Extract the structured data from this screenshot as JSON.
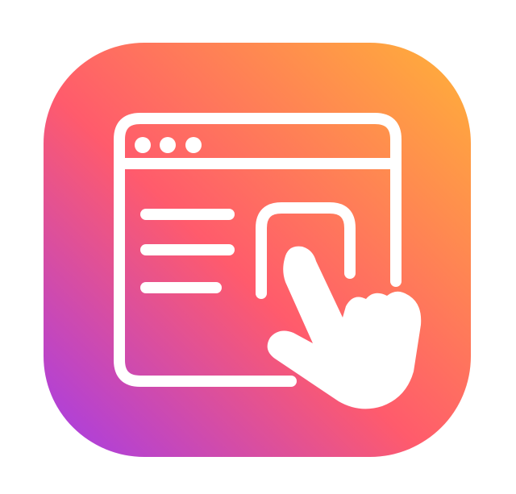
{
  "icon": {
    "name": "web-click-app-icon",
    "colors": {
      "gradient_top_right": "#FFB238",
      "gradient_middle": "#FF5B6C",
      "gradient_bottom_left": "#A43CE8",
      "foreground": "#FFFFFF"
    },
    "elements": [
      "browser-window-icon",
      "window-control-dots",
      "text-lines",
      "button-frame",
      "pointing-hand-icon"
    ]
  }
}
